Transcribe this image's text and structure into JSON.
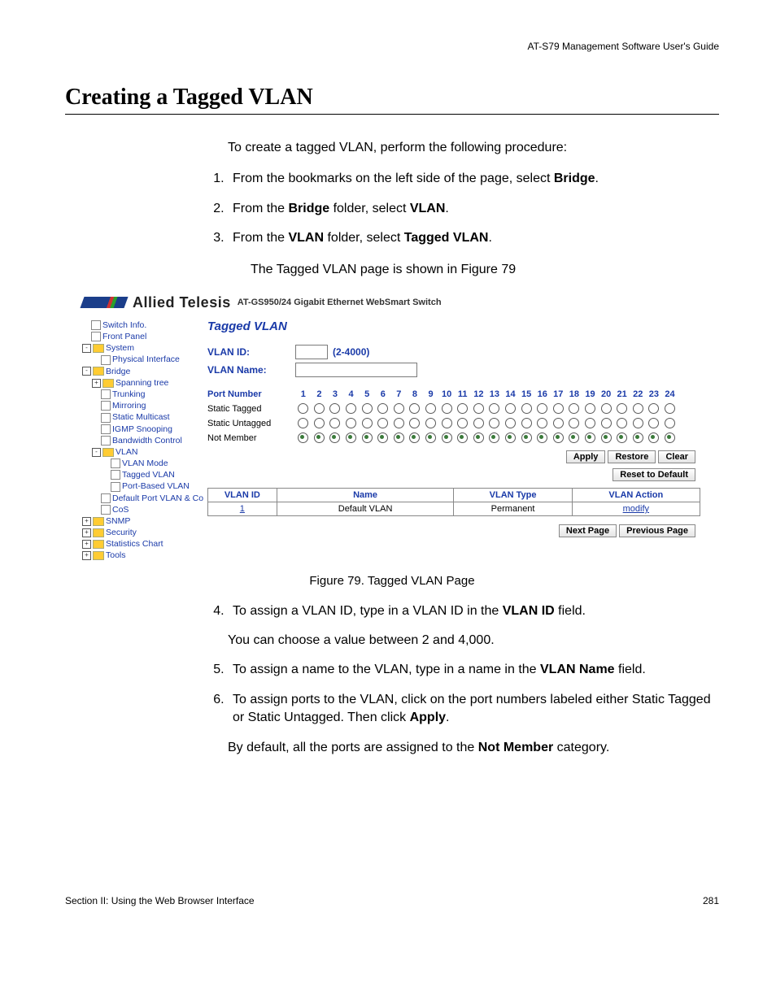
{
  "header": {
    "running": "AT-S79 Management Software User's Guide"
  },
  "title": "Creating a Tagged VLAN",
  "intro": "To create a tagged VLAN, perform the following procedure:",
  "steps_first_block": [
    {
      "pre": "From the bookmarks on the left side of the page, select ",
      "bold": "Bridge",
      "post": "."
    },
    {
      "pre": "From the ",
      "bold": "Bridge",
      "mid": " folder, select ",
      "bold2": "VLAN",
      "post": "."
    },
    {
      "pre": "From the ",
      "bold": "VLAN",
      "mid": " folder, select ",
      "bold2": "Tagged VLAN",
      "post": "."
    }
  ],
  "after3": "The Tagged VLAN page is shown in Figure 79",
  "figure_caption": "Figure 79. Tagged VLAN Page",
  "steps_second_block": [
    {
      "n": 4,
      "pre": "To assign a VLAN ID, type in a VLAN ID in the ",
      "bold": "VLAN ID",
      "post": " field."
    },
    {
      "n": 5,
      "pre": "To assign a name to the VLAN, type in a name in the ",
      "bold": "VLAN Name",
      "post": " field."
    },
    {
      "n": 6,
      "pre": "To assign ports to the VLAN, click on the port numbers labeled either Static Tagged or Static Untagged. Then click ",
      "bold": "Apply",
      "post": "."
    }
  ],
  "after4": "You can choose a value between 2 and 4,000.",
  "after6": {
    "pre": "By default, all the ports are assigned to the ",
    "bold": "Not Member",
    "post": " category."
  },
  "footer": {
    "left": "Section II: Using the Web Browser Interface",
    "right": "281"
  },
  "screenshot": {
    "brand": "Allied Telesis",
    "product": "AT-GS950/24 Gigabit Ethernet WebSmart Switch",
    "tree": [
      {
        "indent": 0,
        "exp": "",
        "icon": "page",
        "label": "Switch Info."
      },
      {
        "indent": 0,
        "exp": "",
        "icon": "page",
        "label": "Front Panel"
      },
      {
        "indent": 0,
        "exp": "⊟",
        "icon": "folder",
        "label": "System"
      },
      {
        "indent": 1,
        "exp": "",
        "icon": "page",
        "label": "Physical Interface"
      },
      {
        "indent": 0,
        "exp": "⊟",
        "icon": "folder",
        "label": "Bridge"
      },
      {
        "indent": 1,
        "exp": "⊞",
        "icon": "folder",
        "label": "Spanning tree"
      },
      {
        "indent": 1,
        "exp": "",
        "icon": "page",
        "label": "Trunking"
      },
      {
        "indent": 1,
        "exp": "",
        "icon": "page",
        "label": "Mirroring"
      },
      {
        "indent": 1,
        "exp": "",
        "icon": "page",
        "label": "Static Multicast"
      },
      {
        "indent": 1,
        "exp": "",
        "icon": "page",
        "label": "IGMP Snooping"
      },
      {
        "indent": 1,
        "exp": "",
        "icon": "page",
        "label": "Bandwidth Control"
      },
      {
        "indent": 1,
        "exp": "⊟",
        "icon": "folder",
        "label": "VLAN"
      },
      {
        "indent": 2,
        "exp": "",
        "icon": "page",
        "label": "VLAN Mode"
      },
      {
        "indent": 2,
        "exp": "",
        "icon": "page",
        "label": "Tagged VLAN"
      },
      {
        "indent": 2,
        "exp": "",
        "icon": "page",
        "label": "Port-Based VLAN"
      },
      {
        "indent": 1,
        "exp": "",
        "icon": "page",
        "label": "Default Port VLAN & Co"
      },
      {
        "indent": 1,
        "exp": "",
        "icon": "page",
        "label": "CoS"
      },
      {
        "indent": 0,
        "exp": "⊞",
        "icon": "folder",
        "label": "SNMP"
      },
      {
        "indent": 0,
        "exp": "⊞",
        "icon": "folder",
        "label": "Security"
      },
      {
        "indent": 0,
        "exp": "⊞",
        "icon": "folder",
        "label": "Statistics Chart"
      },
      {
        "indent": 0,
        "exp": "⊞",
        "icon": "folder",
        "label": "Tools"
      }
    ],
    "heading": "Tagged VLAN",
    "form": {
      "vlan_id_label": "VLAN ID:",
      "vlan_id_hint": "(2-4000)",
      "vlan_name_label": "VLAN Name:"
    },
    "ports": {
      "header_label": "Port Number",
      "columns": [
        "1",
        "2",
        "3",
        "4",
        "5",
        "6",
        "7",
        "8",
        "9",
        "10",
        "11",
        "12",
        "13",
        "14",
        "15",
        "16",
        "17",
        "18",
        "19",
        "20",
        "21",
        "22",
        "23",
        "24"
      ],
      "rows": [
        {
          "label": "Static Tagged",
          "selected": false
        },
        {
          "label": "Static Untagged",
          "selected": false
        },
        {
          "label": "Not Member",
          "selected": true
        }
      ]
    },
    "buttons": {
      "apply": "Apply",
      "restore": "Restore",
      "clear": "Clear",
      "reset": "Reset to Default",
      "next": "Next Page",
      "prev": "Previous Page"
    },
    "table": {
      "headers": [
        "VLAN ID",
        "Name",
        "VLAN Type",
        "VLAN Action"
      ],
      "row": {
        "id": "1",
        "name": "Default VLAN",
        "type": "Permanent",
        "action": "modify"
      }
    }
  }
}
